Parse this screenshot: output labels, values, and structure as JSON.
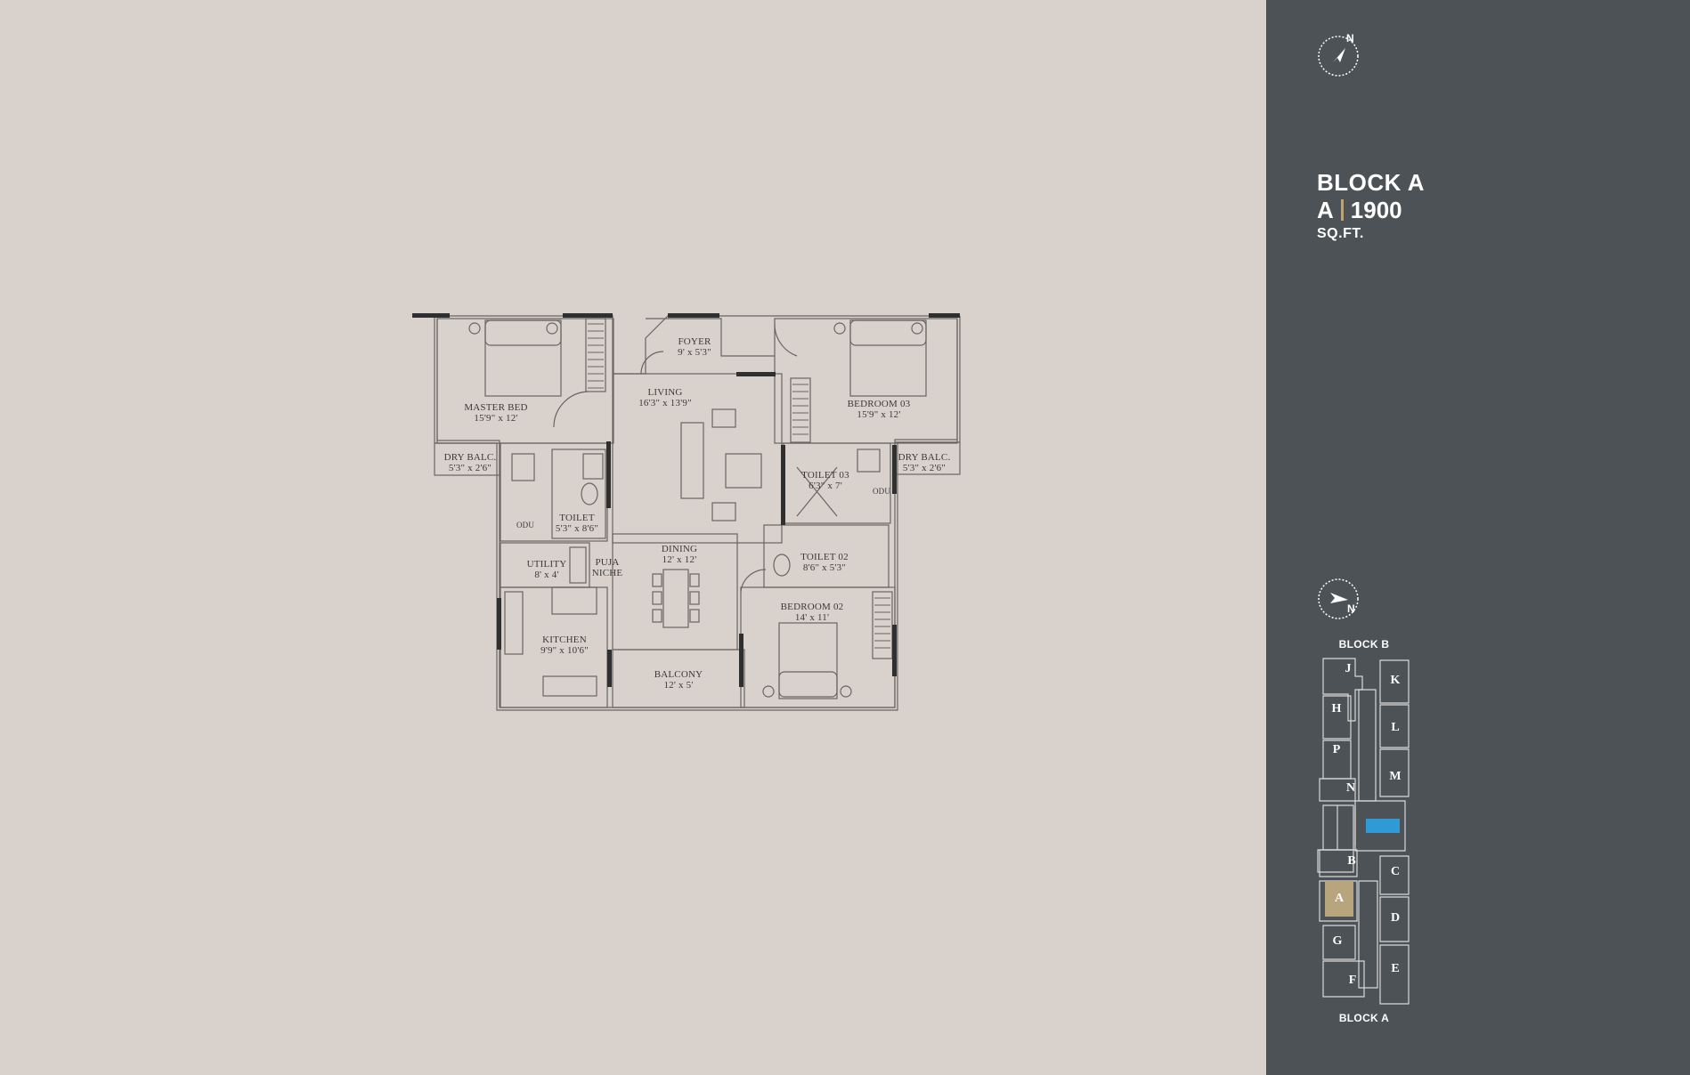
{
  "floor_plan": {
    "rooms": {
      "foyer": {
        "name": "FOYER",
        "dim": "9' x 5'3\""
      },
      "living": {
        "name": "LIVING",
        "dim": "16'3\" x 13'9\""
      },
      "master_bed": {
        "name": "MASTER BED",
        "dim": "15'9\" x 12'"
      },
      "bedroom_03": {
        "name": "BEDROOM 03",
        "dim": "15'9\" x 12'"
      },
      "dry_balc_left": {
        "name": "DRY BALC.",
        "dim": "5'3\" x 2'6\""
      },
      "dry_balc_right": {
        "name": "DRY BALC.",
        "dim": "5'3\" x 2'6\""
      },
      "toilet_03": {
        "name": "TOILET 03",
        "dim": "6'3\" x 7'"
      },
      "toilet": {
        "name": "TOILET",
        "dim": "5'3\" x 8'6\""
      },
      "utility": {
        "name": "UTILITY",
        "dim": "8' x 4'"
      },
      "puja": {
        "name": "PUJA",
        "dim": "NICHE"
      },
      "dining": {
        "name": "DINING",
        "dim": "12' x 12'"
      },
      "toilet_02": {
        "name": "TOILET 02",
        "dim": "8'6\" x 5'3\""
      },
      "bedroom_02": {
        "name": "BEDROOM 02",
        "dim": "14' x 11'"
      },
      "kitchen": {
        "name": "KITCHEN",
        "dim": "9'9\" x 10'6\""
      },
      "balcony": {
        "name": "BALCONY",
        "dim": "12' x 5'"
      }
    },
    "fixture_labels": {
      "odu": "ODU"
    }
  },
  "side_panel": {
    "compass_letter": "N",
    "block_title": "BLOCK A",
    "unit_type": "A",
    "area": "1900",
    "area_unit": "SQ.FT.",
    "keyplan": {
      "compass_letter": "N",
      "top_label": "BLOCK B",
      "bottom_label": "BLOCK A",
      "units": [
        "J",
        "K",
        "H",
        "L",
        "P",
        "M",
        "N",
        "B",
        "C",
        "A",
        "D",
        "G",
        "F",
        "E"
      ],
      "highlight_unit": "A",
      "highlight_color": "#b8a57e",
      "pool_color": "#2f9bd6"
    }
  },
  "colors": {
    "plan_background": "#d9d1cc",
    "panel_background": "#4c5256",
    "line": "#55514e",
    "accent": "#b8a57e"
  }
}
